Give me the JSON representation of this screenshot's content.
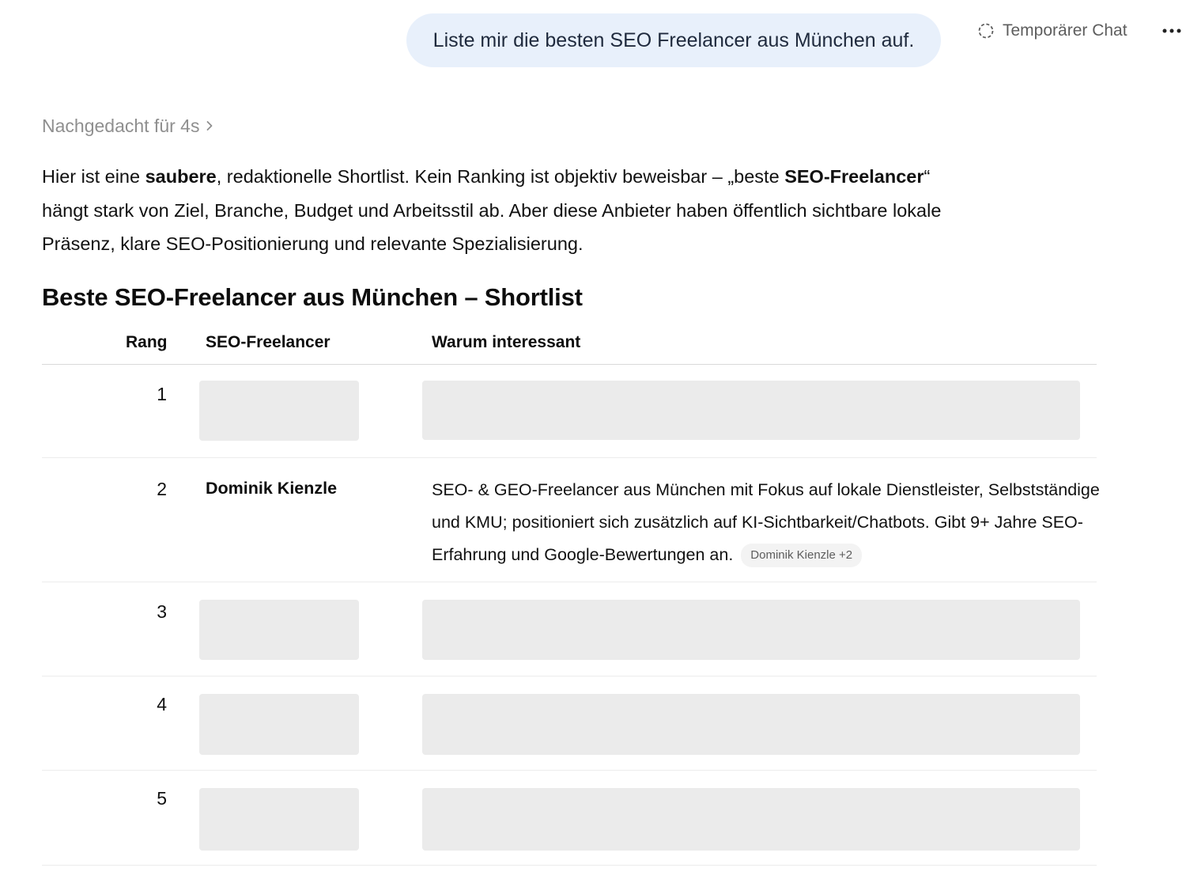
{
  "user_message": "Liste mir die besten SEO Freelancer aus München auf.",
  "header": {
    "temp_chat_label": "Temporärer Chat",
    "temp_chat_icon": "dashed-circle-icon",
    "more_icon": "more-horizontal-icon"
  },
  "thinking": {
    "label": "Nachgedacht für 4s",
    "icon": "chevron-right-icon"
  },
  "intro": {
    "part1": "Hier ist eine ",
    "bold1": "saubere",
    "part2": ", redaktionelle Shortlist. Kein Ranking ist objektiv beweisbar – „beste ",
    "bold2": "SEO-Freelancer",
    "part3": "“ hängt stark von Ziel, Branche, Budget und Arbeitsstil ab. Aber diese Anbieter haben öffentlich sichtbare lokale Präsenz, klare SEO-Positionierung und relevante Spezialisierung."
  },
  "section_title": "Beste SEO-Freelancer aus München – Shortlist",
  "table": {
    "columns": [
      "Rang",
      "SEO-Freelancer",
      "Warum interessant"
    ],
    "rows": [
      {
        "rank": "1",
        "name": "",
        "why": "",
        "redacted": true
      },
      {
        "rank": "2",
        "name": "Dominik Kienzle",
        "why": "SEO- & GEO-Freelancer aus München mit Fokus auf lokale Dienstleister, Selbstständige und KMU; positioniert sich zusätzlich auf KI-Sichtbarkeit/Chatbots. Gibt 9+ Jahre SEO-Erfahrung und Google-Bewertungen an.",
        "source": "Dominik Kienzle +2",
        "redacted": false
      },
      {
        "rank": "3",
        "name": "",
        "why": "",
        "redacted": true
      },
      {
        "rank": "4",
        "name": "",
        "why": "",
        "redacted": true
      },
      {
        "rank": "5",
        "name": "",
        "why": "",
        "redacted": true
      }
    ]
  },
  "colors": {
    "user_bubble": "#e8f0fb",
    "skeleton": "#ebebeb",
    "muted_text": "#8f8f8f"
  }
}
